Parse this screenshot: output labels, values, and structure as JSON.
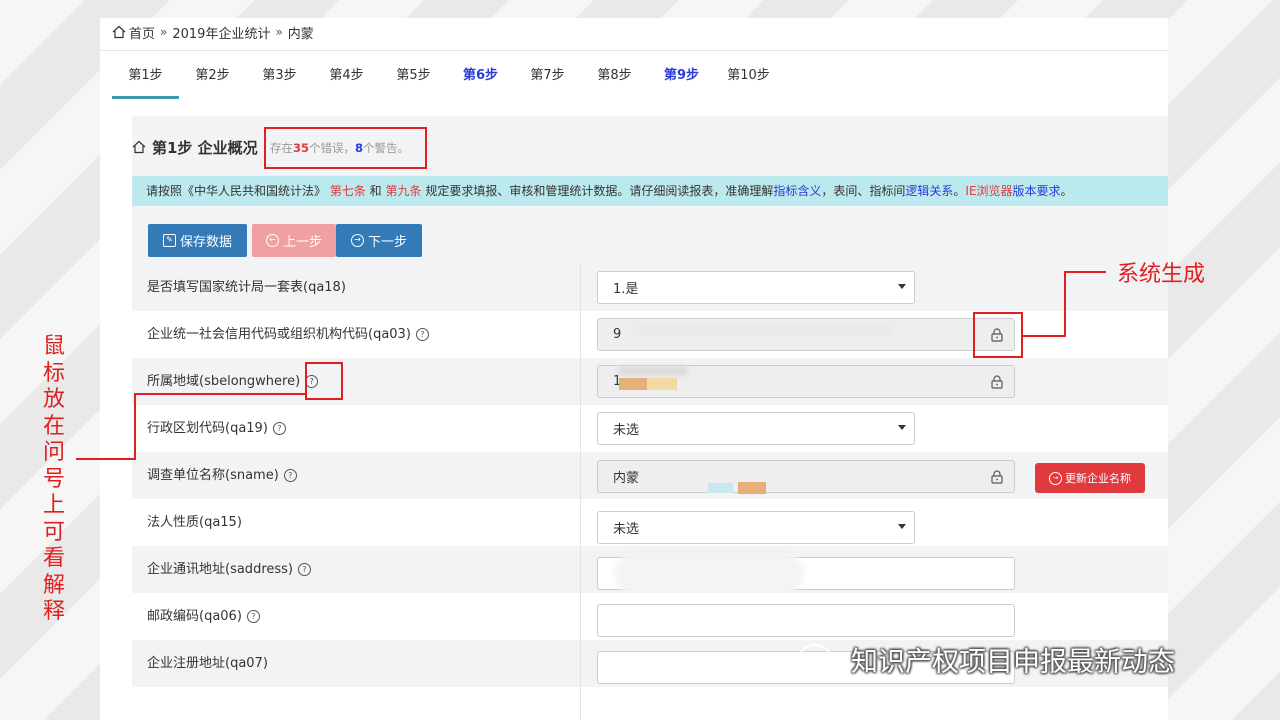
{
  "breadcrumb": {
    "home": "首页",
    "sep1": "»",
    "year": "2019年企业统计",
    "sep2": "»",
    "current": "内蒙"
  },
  "tabs": [
    {
      "label": "第1步",
      "active": true,
      "blue": false
    },
    {
      "label": "第2步",
      "active": false,
      "blue": false
    },
    {
      "label": "第3步",
      "active": false,
      "blue": false
    },
    {
      "label": "第4步",
      "active": false,
      "blue": false
    },
    {
      "label": "第5步",
      "active": false,
      "blue": false
    },
    {
      "label": "第6步",
      "active": false,
      "blue": true
    },
    {
      "label": "第7步",
      "active": false,
      "blue": false
    },
    {
      "label": "第8步",
      "active": false,
      "blue": false
    },
    {
      "label": "第9步",
      "active": false,
      "blue": true
    },
    {
      "label": "第10步",
      "active": false,
      "blue": false
    }
  ],
  "section": {
    "title": "第1步 企业概况",
    "err_prefix": "存在",
    "err_count": "35",
    "err_mid": "个错误，",
    "warn_count": "8",
    "warn_suffix": "个警告。"
  },
  "notice": {
    "p1": "请按照《中华人民共和国统计法》",
    "art7": "第七条",
    "and": " 和 ",
    "art9": "第九条",
    "p2": " 规定要求填报、审核和管理统计数据。请仔细阅读报表，准确理解",
    "link1": "指标含义",
    "p3": "，表间、指标间",
    "link2": "逻辑关系",
    "p4": "。",
    "ie": "IE浏览器",
    "link3": "版本要求",
    "p5": "。"
  },
  "buttons": {
    "save": "保存数据",
    "prev": "上一步",
    "next": "下一步",
    "update": "更新企业名称"
  },
  "rows": [
    {
      "label": "是否填写国家统计局一套表(qa18)",
      "help": false,
      "value": "1.是"
    },
    {
      "label": "企业统一社会信用代码或组织机构代码(qa03)",
      "help": true,
      "value": "9"
    },
    {
      "label": "所属地域(sbelongwhere)",
      "help": true,
      "value": "1"
    },
    {
      "label": "行政区划代码(qa19)",
      "help": true,
      "value": "未选"
    },
    {
      "label": "调查单位名称(sname)",
      "help": true,
      "value": "内蒙"
    },
    {
      "label": "法人性质(qa15)",
      "help": false,
      "value": "未选"
    },
    {
      "label": "企业通讯地址(saddress)",
      "help": true,
      "value": ""
    },
    {
      "label": "邮政编码(qa06)",
      "help": true,
      "value": ""
    },
    {
      "label": "企业注册地址(qa07)",
      "help": false,
      "value": ""
    }
  ],
  "annotations": {
    "system": "系统生成",
    "vertical": [
      "鼠",
      "标",
      "放",
      "在",
      "问",
      "号",
      "上",
      "可",
      "看",
      "解",
      "释"
    ]
  },
  "watermark": "知识产权项目申报最新动态",
  "colors": {
    "accent": "#337ab7",
    "danger": "#e0393e",
    "annotation": "#e02020",
    "notice_bg": "#bce9ee",
    "tab_underline": "#3a9bb0"
  }
}
